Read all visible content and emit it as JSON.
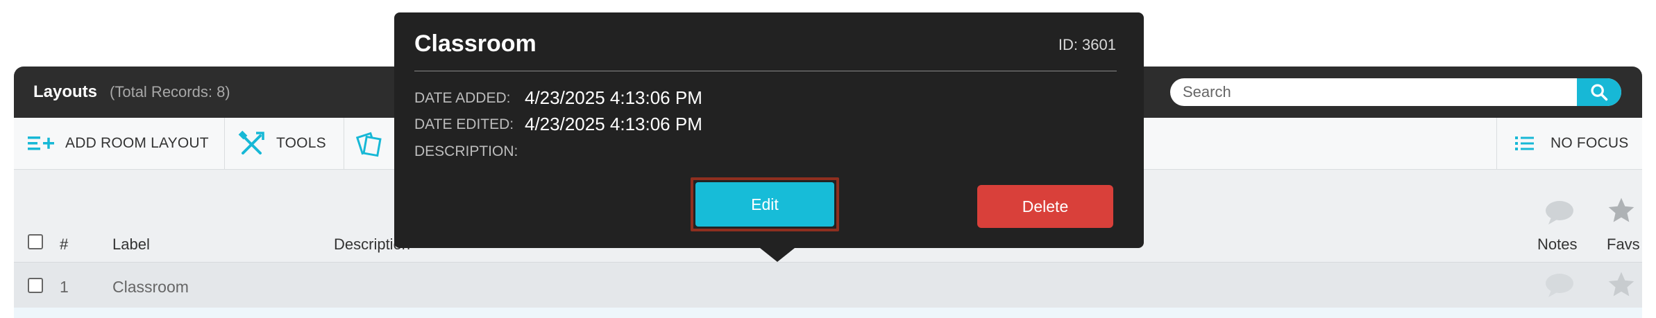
{
  "layouts_panel": {
    "title": "Layouts",
    "total_records": "(Total Records: 8)",
    "search_placeholder": "Search"
  },
  "toolbar": {
    "add_room_layout": "ADD ROOM LAYOUT",
    "tools": "TOOLS",
    "no_focus": "NO FOCUS"
  },
  "table": {
    "headers": {
      "number": "#",
      "label": "Label",
      "description": "Description",
      "notes": "Notes",
      "favs": "Favs"
    },
    "rows": [
      {
        "number": "1",
        "label": "Classroom"
      }
    ]
  },
  "popover": {
    "title": "Classroom",
    "id_text": "ID: 3601",
    "date_added_label": "DATE ADDED:",
    "date_added_value": "4/23/2025 4:13:06 PM",
    "date_edited_label": "DATE EDITED:",
    "date_edited_value": "4/23/2025 4:13:06 PM",
    "description_label": "DESCRIPTION:",
    "edit_label": "Edit",
    "delete_label": "Delete"
  },
  "colors": {
    "accent": "#17b8d6",
    "delete": "#d9403a",
    "header_bg": "#2d2d2d",
    "popover_bg": "#222222"
  },
  "icons": [
    "search-icon",
    "list-add-icon",
    "tools-icon",
    "layers-icon",
    "list-icon",
    "comment-icon",
    "star-icon"
  ]
}
